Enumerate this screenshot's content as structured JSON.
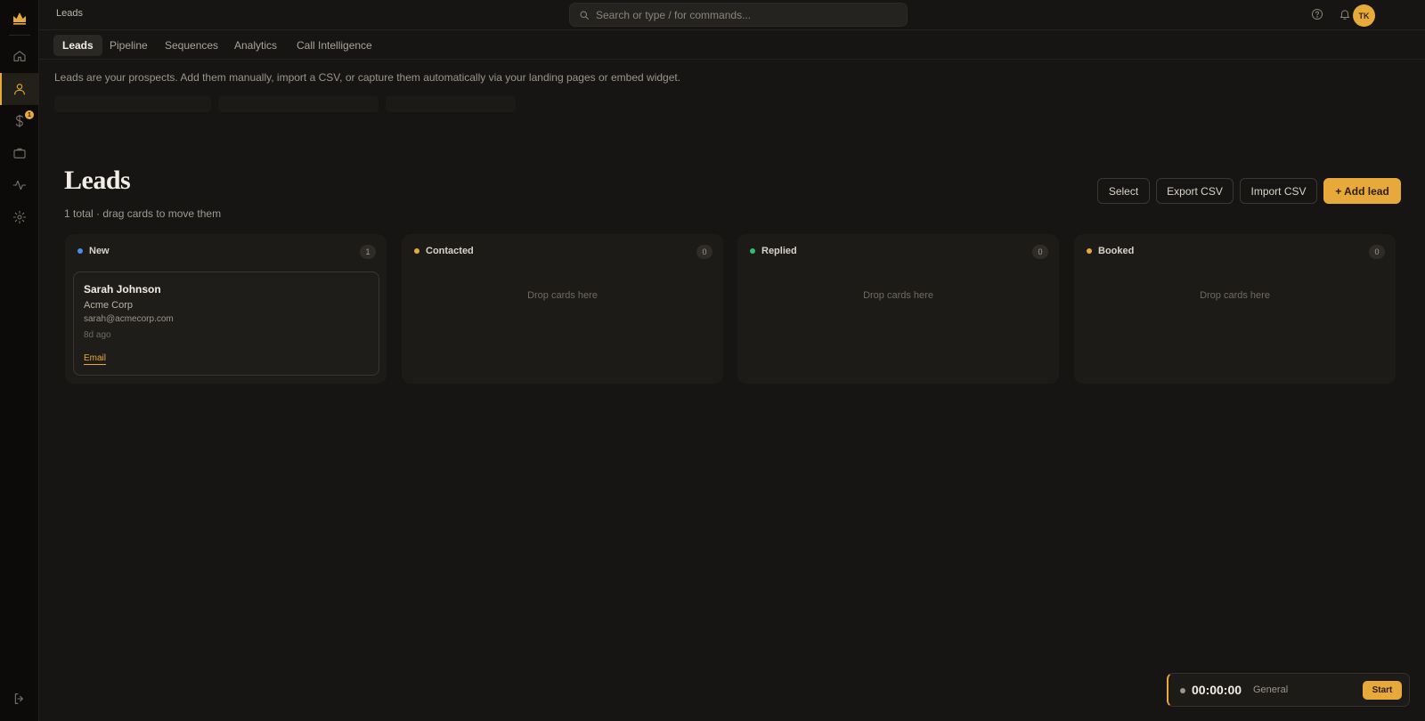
{
  "app": {
    "logo_icon": "crown-icon",
    "accent_color": "#e8a93b"
  },
  "sidebar": {
    "items": [
      {
        "name": "home",
        "icon": "home-icon"
      },
      {
        "name": "leads",
        "icon": "user-icon",
        "active": true
      },
      {
        "name": "billing",
        "icon": "dollar-icon",
        "badge": "1"
      },
      {
        "name": "portfolio",
        "icon": "briefcase-icon"
      },
      {
        "name": "activity",
        "icon": "activity-icon"
      },
      {
        "name": "settings",
        "icon": "gear-icon"
      }
    ],
    "logout_icon": "logout-icon"
  },
  "topbar": {
    "title": "Leads",
    "search_placeholder": "Search or type / for commands...",
    "help_icon": "help-icon",
    "notification_icon": "bell-icon",
    "avatar_initials": "TK"
  },
  "tabs": [
    {
      "label": "Leads",
      "active": true
    },
    {
      "label": "Pipeline"
    },
    {
      "label": "Sequences"
    },
    {
      "label": "Analytics"
    },
    {
      "label": "Call Intelligence"
    }
  ],
  "intro": "Leads are your prospects. Add them manually, import a CSV, or capture them automatically via your landing pages or embed widget.",
  "page": {
    "title": "Leads",
    "subtitle": "1 total · drag cards to move them",
    "buttons": {
      "select": "Select",
      "export": "Export CSV",
      "import": "Import CSV",
      "add": "+ Add lead"
    }
  },
  "columns": [
    {
      "title": "New",
      "count": "1",
      "color": "#4a8cf0"
    },
    {
      "title": "Contacted",
      "count": "0",
      "color": "#e8a93b",
      "empty_text": "Drop cards here"
    },
    {
      "title": "Replied",
      "count": "0",
      "color": "#2fbf71",
      "empty_text": "Drop cards here"
    },
    {
      "title": "Booked",
      "count": "0",
      "color": "#e8a93b",
      "empty_text": "Drop cards here"
    }
  ],
  "lead_card": {
    "name": "Sarah Johnson",
    "company": "Acme Corp",
    "email": "sarah@acmecorp.com",
    "age": "8d ago",
    "action": "Email"
  },
  "timer": {
    "time": "00:00:00",
    "label": "General",
    "start": "Start"
  }
}
